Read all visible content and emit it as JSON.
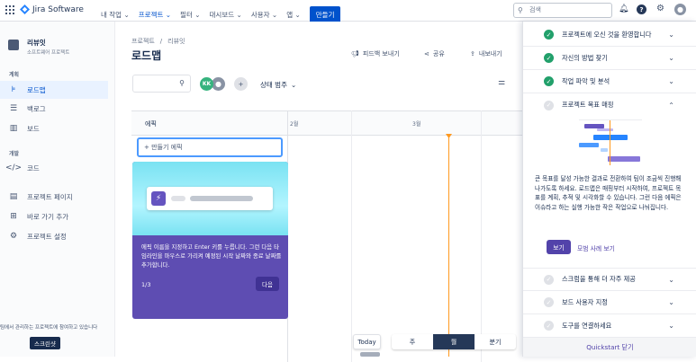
{
  "topnav": {
    "app_name": "Jira Software",
    "items": [
      "내 작업",
      "프로젝트",
      "필터",
      "대시보드",
      "사용자",
      "앱"
    ],
    "create_label": "만들기",
    "search_placeholder": "검색"
  },
  "sidebar": {
    "project_name": "리뷰잇",
    "project_type": "소프트웨어 프로젝트",
    "planning_label": "계획",
    "planning_items": [
      "로드맵",
      "백로그",
      "보드"
    ],
    "dev_label": "개발",
    "dev_items": [
      "코드"
    ],
    "other_items": [
      "프로젝트 페이지",
      "바로 가기 추가",
      "프로젝트 설정"
    ],
    "footer_text": "팀에서 관리하는 프로젝트에 참여하고 있습니다",
    "tooltip": "스크린샷"
  },
  "main": {
    "breadcrumb_projects": "프로젝트",
    "breadcrumb_sep": "/",
    "breadcrumb_project": "리뷰잇",
    "title": "로드맵",
    "actions": {
      "feedback": "피드백 보내기",
      "share": "공유",
      "export": "내보내기"
    },
    "avatar_initials": "KK",
    "status_filter": "상태 범주",
    "epic_header": "에픽",
    "months": [
      "2월",
      "3월"
    ],
    "create_epic": "+ 만들기 에픽",
    "onboarding_text": "에픽 이름을 지정하고 Enter 키를 누릅니다. 그런 다음 타임라인을 마우스로 가리켜 예정된 시작 날짜와 종료 날짜를 추가합니다.",
    "onboarding_step": "1/3",
    "onboarding_next": "다음",
    "today_label": "Today",
    "view_tabs": [
      "주",
      "월",
      "분기"
    ],
    "active_view": "월"
  },
  "quickstart": {
    "items_top": [
      {
        "title": "프로젝트에 오신 것을 환영합니다",
        "done": true
      },
      {
        "title": "자신의 방법 찾기",
        "done": true
      },
      {
        "title": "작업 파악 및 분석",
        "done": true
      },
      {
        "title": "프로젝트 목표 매핑",
        "done": false
      }
    ],
    "expanded_text": "큰 목표를 달성 가능한 결과로 전환하여 팀이 조금씩 진행해 나가도록 하세요. 로드맵은 매핑부터 시작하여, 프로젝트 목표를 계획, 추적 및 시각화할 수 있습니다. 그런 다음 에픽은 이슈라고 하는 실행 가능한 작은 작업으로 나눠집니다.",
    "view_button": "보기",
    "example_link": "모범 사례 보기",
    "items_bottom": [
      {
        "title": "스크럼을 통해 더 자주 제공",
        "done": false
      },
      {
        "title": "보드 사용자 지정",
        "done": false
      },
      {
        "title": "도구를 연결하세요",
        "done": false
      }
    ],
    "close_label": "Quickstart 닫기"
  }
}
